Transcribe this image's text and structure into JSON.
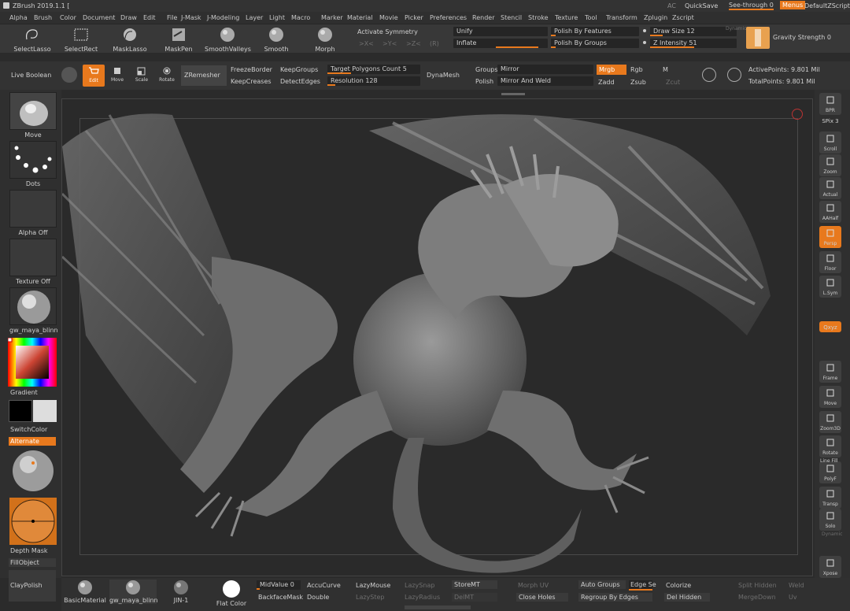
{
  "app": {
    "title": "ZBrush 2019.1.1 ["
  },
  "top_right": {
    "ac": "AC",
    "quicksave": "QuickSave",
    "seethrough": "See-through  0",
    "menus": "Menus",
    "default_zscript": "DefaultZScript"
  },
  "menubar": [
    "Alpha",
    "Brush",
    "Color",
    "Document",
    "Draw",
    "Edit",
    "File",
    "J-Mask",
    "J-Modeling",
    "Layer",
    "Light",
    "Macro",
    "Marker",
    "Material",
    "Movie",
    "Picker",
    "Preferences",
    "Render",
    "Stencil",
    "Stroke",
    "Texture",
    "Tool",
    "Transform",
    "Zplugin",
    "Zscript"
  ],
  "toolbar1": {
    "select_lasso": "SelectLasso",
    "select_rect": "SelectRect",
    "mask_lasso": "MaskLasso",
    "mask_pen": "MaskPen",
    "smooth_valleys": "SmoothValleys",
    "smooth": "Smooth",
    "morph": "Morph",
    "activate_symmetry": "Activate Symmetry",
    "sym_x": ">X<",
    "sym_y": ">Y<",
    "sym_z": ">Z<",
    "sym_r": "(R)",
    "unify": "Unify",
    "inflate": "Inflate",
    "polish_features": "Polish By Features",
    "polish_groups": "Polish By Groups",
    "draw_size": "Draw Size 12",
    "z_intensity": "Z Intensity 51",
    "dynamic": "Dynamic",
    "gravity": "Gravity Strength 0"
  },
  "toolbar2": {
    "live_boolean": "Live Boolean",
    "edit": "Edit",
    "move": "Move",
    "scale": "Scale",
    "rotate": "Rotate",
    "zremesher": "ZRemesher",
    "freeze_border": "FreezeBorder",
    "keep_groups": "KeepGroups",
    "keep_creases": "KeepCreases",
    "detect_edges": "DetectEdges",
    "target_polys": "Target Polygons Count 5",
    "resolution": "Resolution 128",
    "dynamesh": "DynaMesh",
    "groups": "Groups",
    "polish": "Polish",
    "mirror": "Mirror",
    "mirror_weld": "Mirror And Weld",
    "mrgb": "Mrgb",
    "rgb": "Rgb",
    "m": "M",
    "zadd": "Zadd",
    "zsub": "Zsub",
    "zcut": "Zcut",
    "active_points": "ActivePoints: 9.801 Mil",
    "total_points": "TotalPoints: 9.801 Mil"
  },
  "left_shelf": {
    "brush": "Move",
    "stroke": "Dots",
    "alpha": "Alpha Off",
    "texture": "Texture Off",
    "material": "gw_maya_blinn",
    "gradient": "Gradient",
    "switch_color": "SwitchColor",
    "alternate": "Alternate",
    "depth_mask": "Depth Mask",
    "fill_object": "FillObject",
    "clay_polish": "ClayPolish"
  },
  "right_shelf": [
    {
      "name": "bpr",
      "label": "BPR"
    },
    {
      "name": "spix",
      "label": "SPix 3"
    },
    {
      "name": "scroll",
      "label": "Scroll"
    },
    {
      "name": "zoom",
      "label": "Zoom"
    },
    {
      "name": "actual",
      "label": "Actual"
    },
    {
      "name": "aahalf",
      "label": "AAHalf"
    },
    {
      "name": "persp",
      "label": "Persp"
    },
    {
      "name": "floor",
      "label": "Floor"
    },
    {
      "name": "lsym",
      "label": "L.Sym"
    },
    {
      "name": "xyz",
      "label": "Qxyz"
    },
    {
      "name": "frame",
      "label": "Frame"
    },
    {
      "name": "move",
      "label": "Move"
    },
    {
      "name": "zoom3d",
      "label": "Zoom3D"
    },
    {
      "name": "rotate",
      "label": "Rotate"
    },
    {
      "name": "polyf",
      "label": "PolyF"
    },
    {
      "name": "transp",
      "label": "Transp"
    },
    {
      "name": "solo",
      "label": "Solo"
    },
    {
      "name": "xpose",
      "label": "Xpose"
    }
  ],
  "right_extra": {
    "dynamic": "Dynamic",
    "linefill": "Line Fill"
  },
  "bottom": {
    "basic_material": "BasicMaterial",
    "gw_maya_blinn": "gw_maya_blinn",
    "jin1": "JIN-1",
    "flat_color": "Flat Color",
    "mid_value": "MidValue 0",
    "backface_mask": "BackfaceMask",
    "accu_curve": "AccuCurve",
    "double": "Double",
    "lazy_mouse": "LazyMouse",
    "lazy_snap": "LazySnap",
    "lazy_step": "LazyStep",
    "lazy_radius": "LazyRadius",
    "store_mt": "StoreMT",
    "del_mt": "DelMT",
    "morph_uv": "Morph UV",
    "close_holes": "Close Holes",
    "auto_groups": "Auto Groups",
    "edge_se": "Edge Se",
    "regroup_edges": "Regroup By Edges",
    "colorize": "Colorize",
    "del_hidden": "Del Hidden",
    "split_hidden": "Split Hidden",
    "merge_down": "MergeDown",
    "weld": "Weld",
    "uv": "Uv"
  },
  "colors": {
    "accent": "#e8791d",
    "bg": "#2b2b2b",
    "panel": "#383838"
  }
}
